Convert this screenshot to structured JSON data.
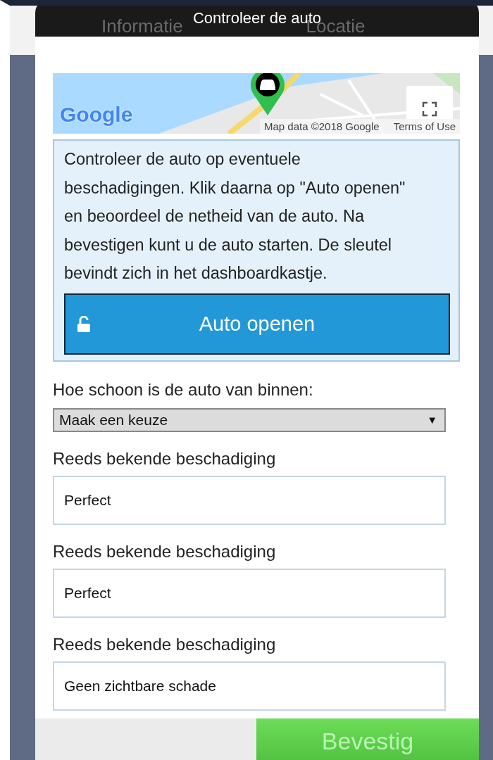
{
  "background": {
    "tabs": [
      {
        "label": "Informatie"
      },
      {
        "label": "Locatie"
      }
    ]
  },
  "dialog": {
    "title": "Controleer de auto"
  },
  "map": {
    "logo": "Google",
    "attribution": "Map data ©2018 Google",
    "terms_link": "Terms of Use"
  },
  "instructions": {
    "text": "Controleer de auto op eventuele beschadigingen. Klik daarna op \"Auto openen\" en beoordeel de netheid van de auto. Na bevestigen kunt u de auto starten. De sleutel bevindt zich in het dashboardkastje.",
    "unlock_button": "Auto openen"
  },
  "cleanliness": {
    "label": "Hoe schoon is de auto van binnen:",
    "value": "Maak een keuze",
    "arrow": "▼"
  },
  "damage_fields": [
    {
      "label": "Reeds bekende beschadiging",
      "value": "Perfect"
    },
    {
      "label": "Reeds bekende beschadiging",
      "value": "Perfect"
    },
    {
      "label": "Reeds bekende beschadiging",
      "value": "Geen zichtbare schade"
    }
  ],
  "footer": {
    "confirm_button": "Bevestig"
  }
}
